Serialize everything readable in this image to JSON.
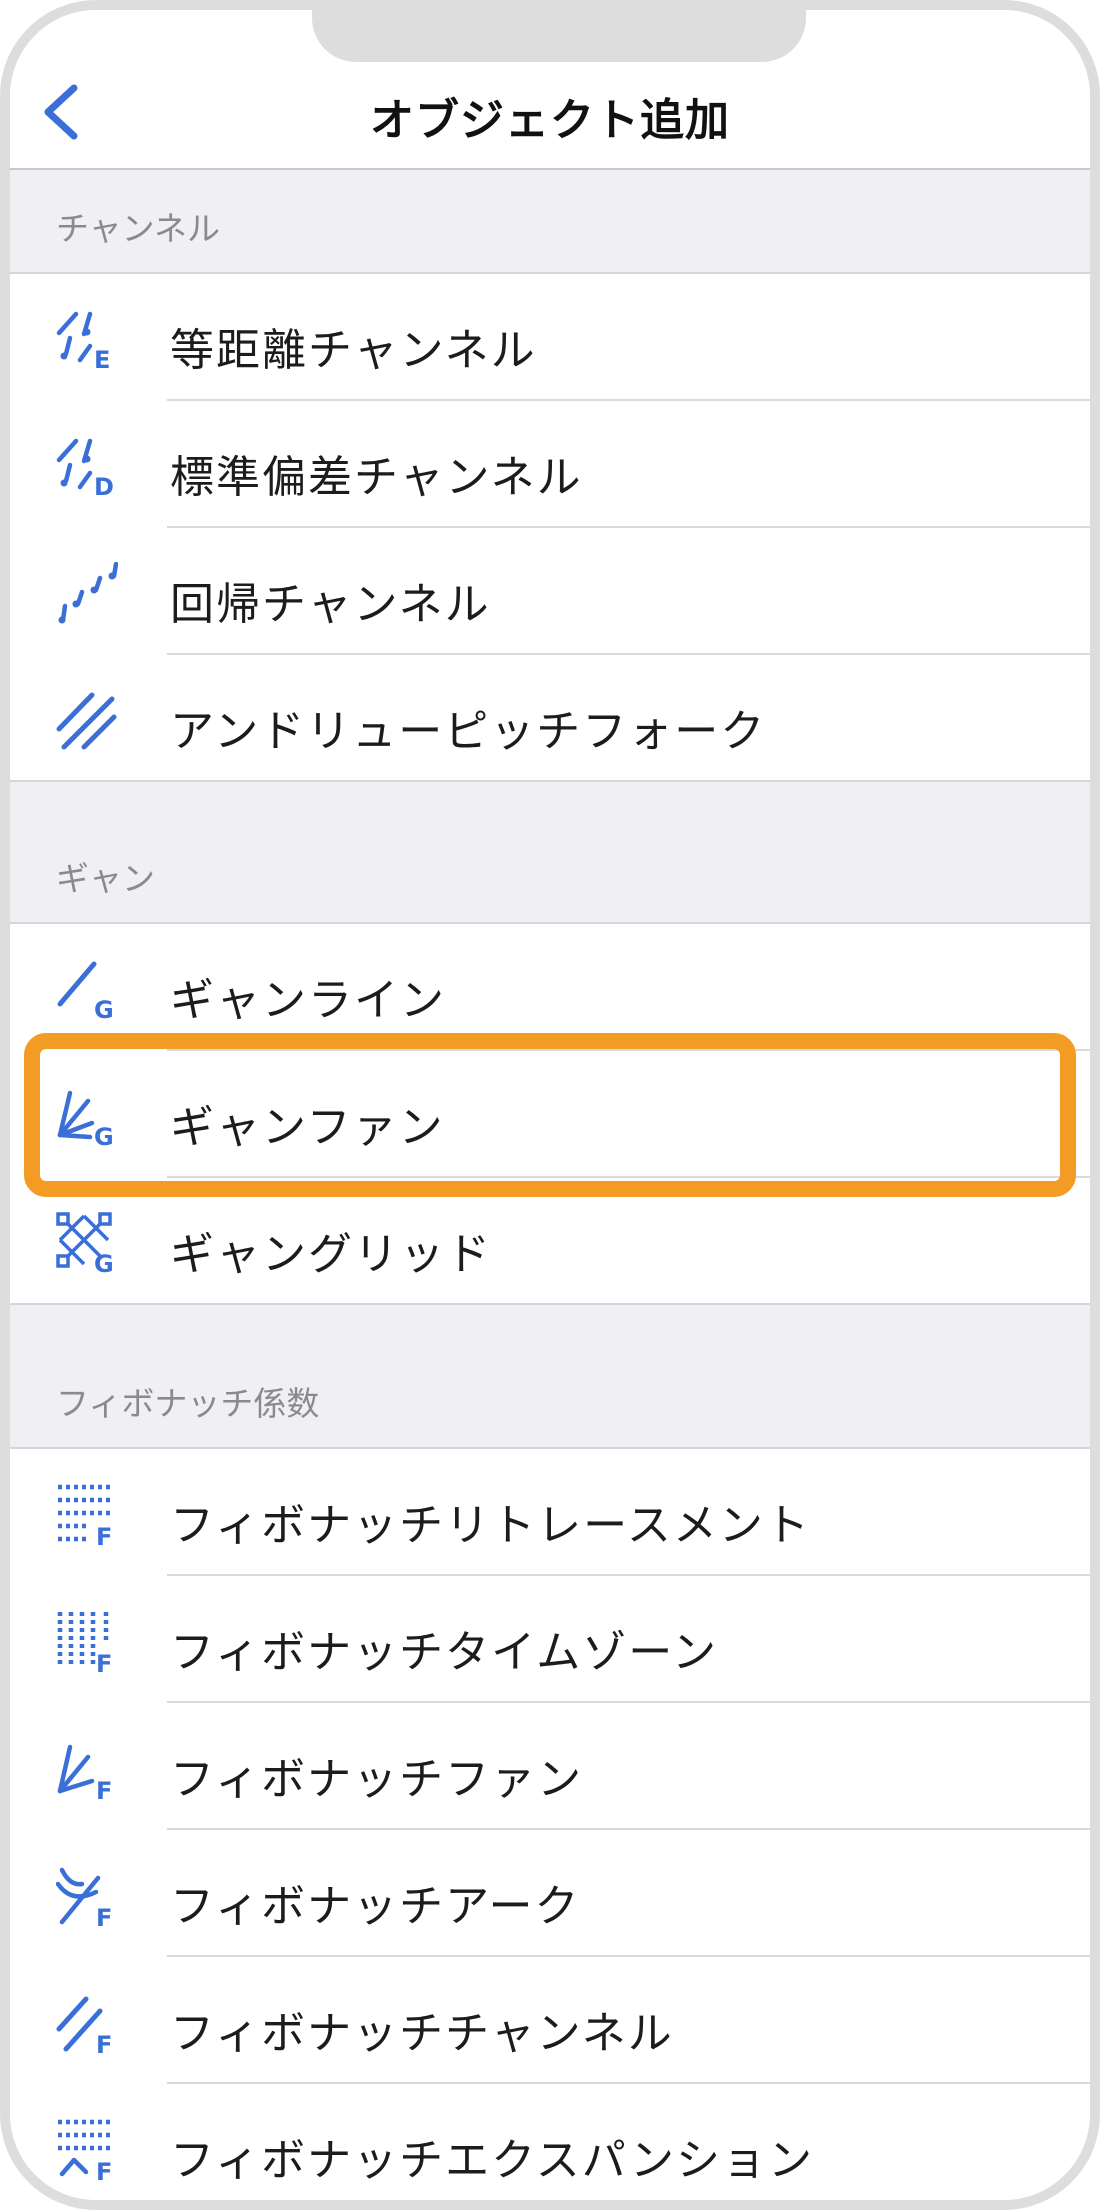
{
  "header": {
    "title": "オブジェクト追加"
  },
  "sections": [
    {
      "title": "チャンネル",
      "items": [
        {
          "label": "等距離チャンネル",
          "icon": "equidistant-channel-icon",
          "badge": "E"
        },
        {
          "label": "標準偏差チャンネル",
          "icon": "std-deviation-channel-icon",
          "badge": "D"
        },
        {
          "label": "回帰チャンネル",
          "icon": "regression-channel-icon"
        },
        {
          "label": "アンドリューピッチフォーク",
          "icon": "andrews-pitchfork-icon"
        }
      ]
    },
    {
      "title": "ギャン",
      "items": [
        {
          "label": "ギャンライン",
          "icon": "gann-line-icon",
          "badge": "G"
        },
        {
          "label": "ギャンファン",
          "icon": "gann-fan-icon",
          "badge": "G",
          "highlighted": true
        },
        {
          "label": "ギャングリッド",
          "icon": "gann-grid-icon",
          "badge": "G"
        }
      ]
    },
    {
      "title": "フィボナッチ係数",
      "items": [
        {
          "label": "フィボナッチリトレースメント",
          "icon": "fibonacci-retracement-icon",
          "badge": "F"
        },
        {
          "label": "フィボナッチタイムゾーン",
          "icon": "fibonacci-timezone-icon",
          "badge": "F"
        },
        {
          "label": "フィボナッチファン",
          "icon": "fibonacci-fan-icon",
          "badge": "F"
        },
        {
          "label": "フィボナッチアーク",
          "icon": "fibonacci-arc-icon",
          "badge": "F"
        },
        {
          "label": "フィボナッチチャンネル",
          "icon": "fibonacci-channel-icon",
          "badge": "F"
        },
        {
          "label": "フィボナッチエクスパンション",
          "icon": "fibonacci-expansion-icon",
          "badge": "F"
        }
      ]
    }
  ],
  "colors": {
    "accent": "#3a6fd8",
    "highlight": "#f39c25",
    "section_bg": "#efeff4"
  }
}
